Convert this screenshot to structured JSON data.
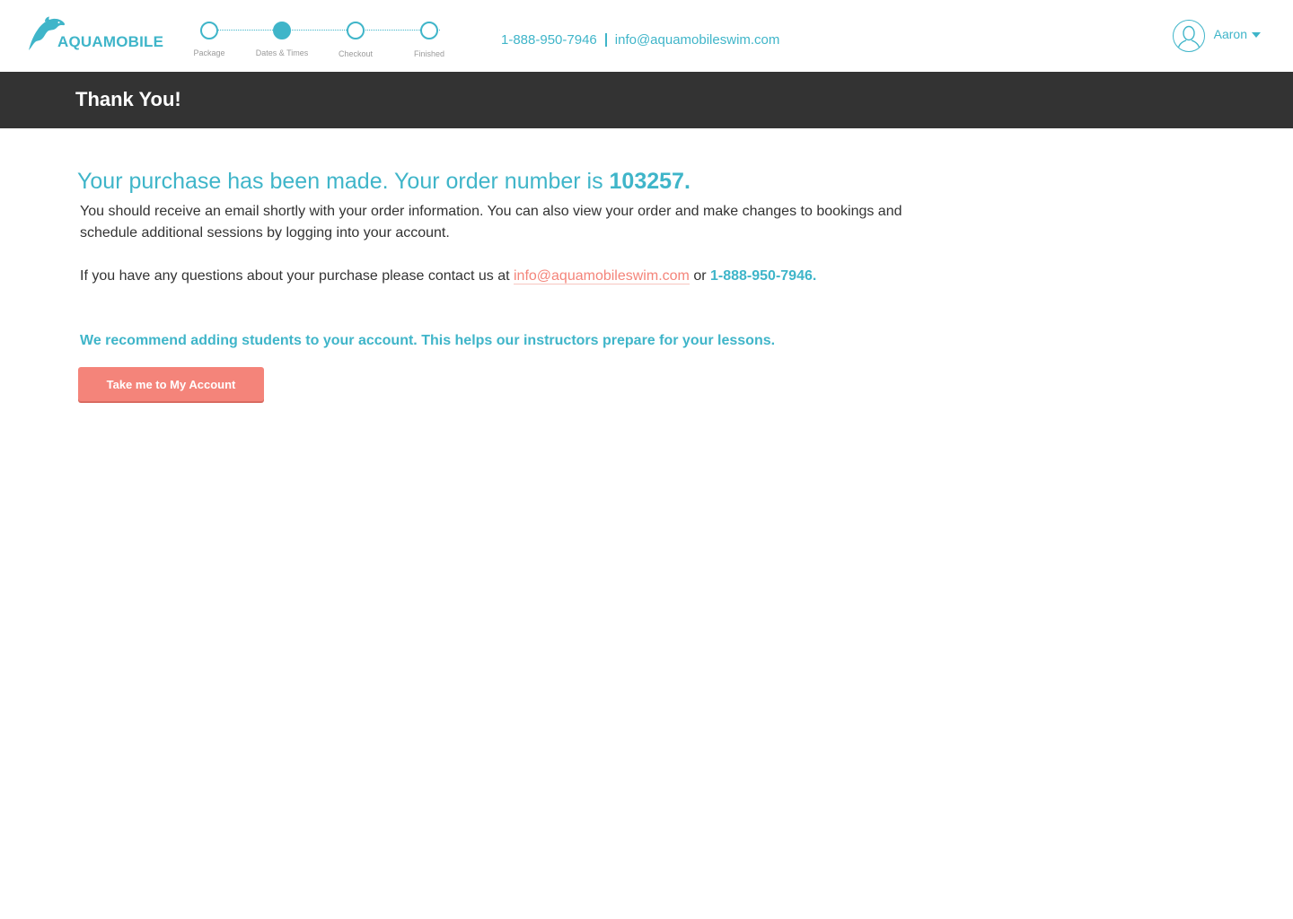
{
  "brand": {
    "name": "AQUAMOBILE",
    "accent_color": "#3fb5c9",
    "cta_color": "#f4847a",
    "logo_icon": "dolphin-icon"
  },
  "steps": [
    {
      "label": "Package",
      "active": false
    },
    {
      "label": "Dates & Times",
      "active": true
    },
    {
      "label": "Checkout",
      "active": false
    },
    {
      "label": "Finished",
      "active": false
    }
  ],
  "contact": {
    "phone": "1-888-950-7946",
    "email": "info@aquamobileswim.com"
  },
  "user": {
    "name": "Aaron",
    "avatar_icon": "user-avatar-icon",
    "menu_icon": "caret-down-icon"
  },
  "page": {
    "title": "Thank You!"
  },
  "main": {
    "headline_prefix": "Your purchase has been made. Your order number is",
    "order_number": "103257.",
    "paragraph1": "You should receive an email shortly with your order information. You can also view your order and make changes to bookings and schedule additional sessions by logging into your account.",
    "paragraph2_prefix": "If you have any questions about your purchase please contact us at",
    "paragraph2_email": "info@aquamobileswim.com",
    "paragraph2_or": "or",
    "paragraph2_phone": "1-888-950-7946.",
    "recommend": "We recommend adding students to your account. This helps our instructors prepare for your lessons.",
    "button_label": "Take me to My Account"
  }
}
